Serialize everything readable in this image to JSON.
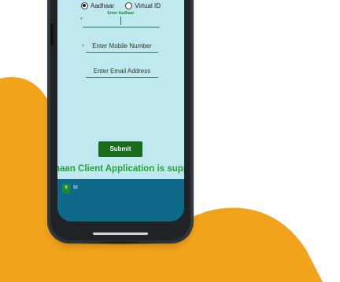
{
  "form": {
    "options": [
      {
        "label": "Aadhaar",
        "selected": true
      },
      {
        "label": "Virtual ID",
        "selected": false
      }
    ],
    "aadhaar_caption": "Enter Aadhaar",
    "mobile_placeholder": "Enter Mobile Number",
    "email_placeholder": "Enter Email Address",
    "required_mark": "*",
    "submit_label": "Submit"
  },
  "banner": {
    "text": "naan Client Application is supp"
  },
  "status_bar": {
    "icon_label": "₹",
    "text": "$$"
  },
  "colors": {
    "accent_orange": "#f2a31c",
    "screen_bg": "#bfe9ee",
    "submit_green": "#1b6b1c",
    "banner_green": "#23a23a"
  }
}
